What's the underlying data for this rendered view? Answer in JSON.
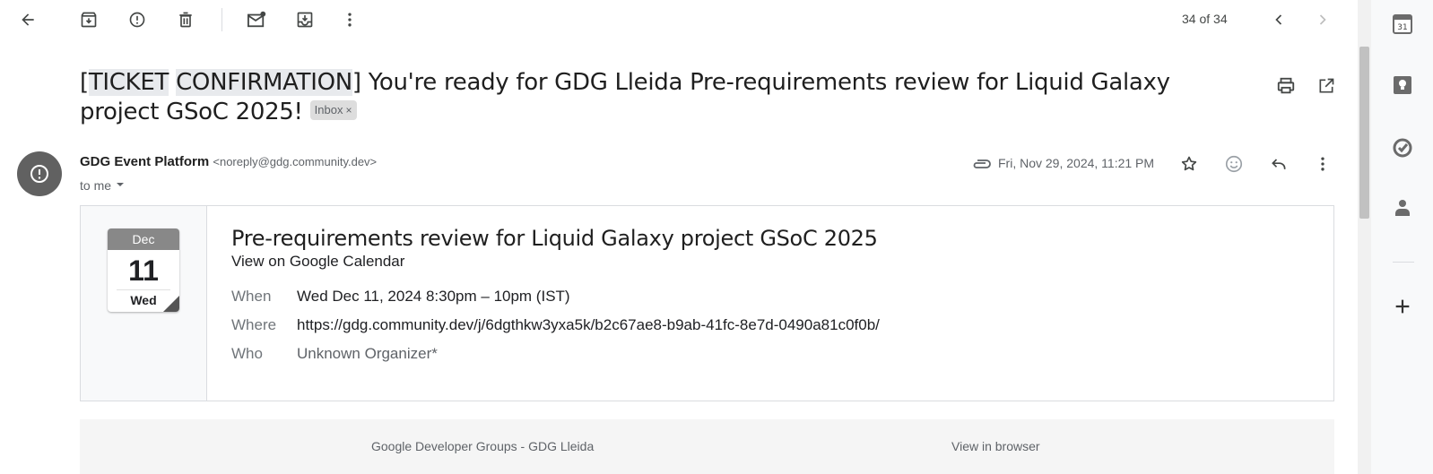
{
  "toolbar": {
    "counter": "34 of 34"
  },
  "subject": {
    "highlight1": "TICKET",
    "highlight2": "CONFIRMATION",
    "rest": "] You're ready for GDG Lleida Pre-requirements review for Liquid Galaxy project GSoC 2025!",
    "label": "Inbox"
  },
  "sender": {
    "name": "GDG Event Platform",
    "email": "<noreply@gdg.community.dev>",
    "to": "to me",
    "date": "Fri, Nov 29, 2024, 11:21 PM"
  },
  "event": {
    "cal_month": "Dec",
    "cal_day": "11",
    "cal_weekday": "Wed",
    "title": "Pre-requirements review for Liquid Galaxy project GSoC 2025",
    "calendar_link": "View on Google Calendar",
    "when_label": "When",
    "when_value": "Wed Dec 11, 2024 8:30pm – 10pm (IST)",
    "where_label": "Where",
    "where_value": "https://gdg.community.dev/j/6dgthkw3yxa5k/b2c67ae8-b9ab-41fc-8e7d-0490a81c0f0b/",
    "who_label": "Who",
    "who_value": "Unknown Organizer*"
  },
  "footer": {
    "org": "Google Developer Groups - GDG Lleida",
    "view_browser": "View in browser"
  },
  "side_panel": {
    "calendar_day": "31"
  },
  "colors": {
    "text": "#202124",
    "muted": "#5f6368",
    "avatar": "#616161",
    "chip": "#dddddd"
  }
}
